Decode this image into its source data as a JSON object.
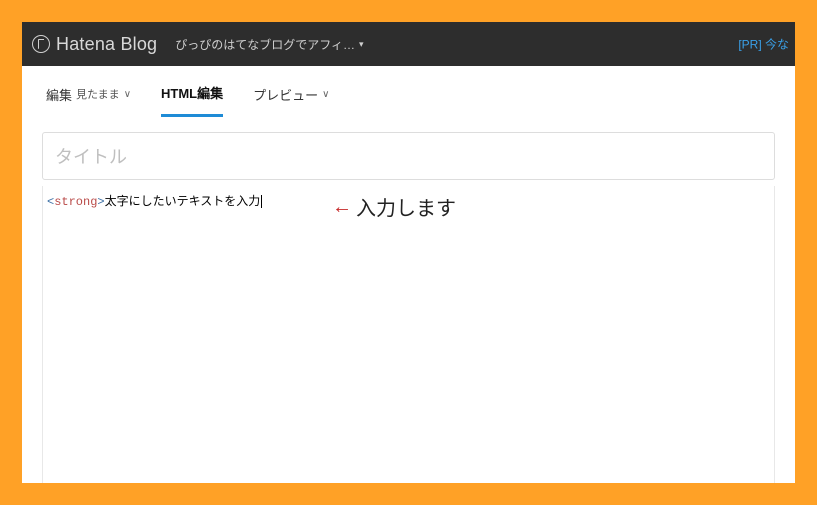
{
  "header": {
    "logo_text": "Hatena Blog",
    "subtitle": "ぴっぴのはてなブログでアフィ…",
    "caret": "▾",
    "pr_link": "[PR] 今な"
  },
  "tabs": {
    "edit_label": "編集",
    "edit_sub": "見たまま",
    "html_label": "HTML編集",
    "preview_label": "プレビュー",
    "chev": "∨"
  },
  "title": {
    "placeholder": "タイトル"
  },
  "editor": {
    "open_br": "<",
    "tag": "strong",
    "close_br": ">",
    "body_text": "太字にしたいテキストを入力"
  },
  "annotation": {
    "arrow": "←",
    "text": "入力します"
  }
}
